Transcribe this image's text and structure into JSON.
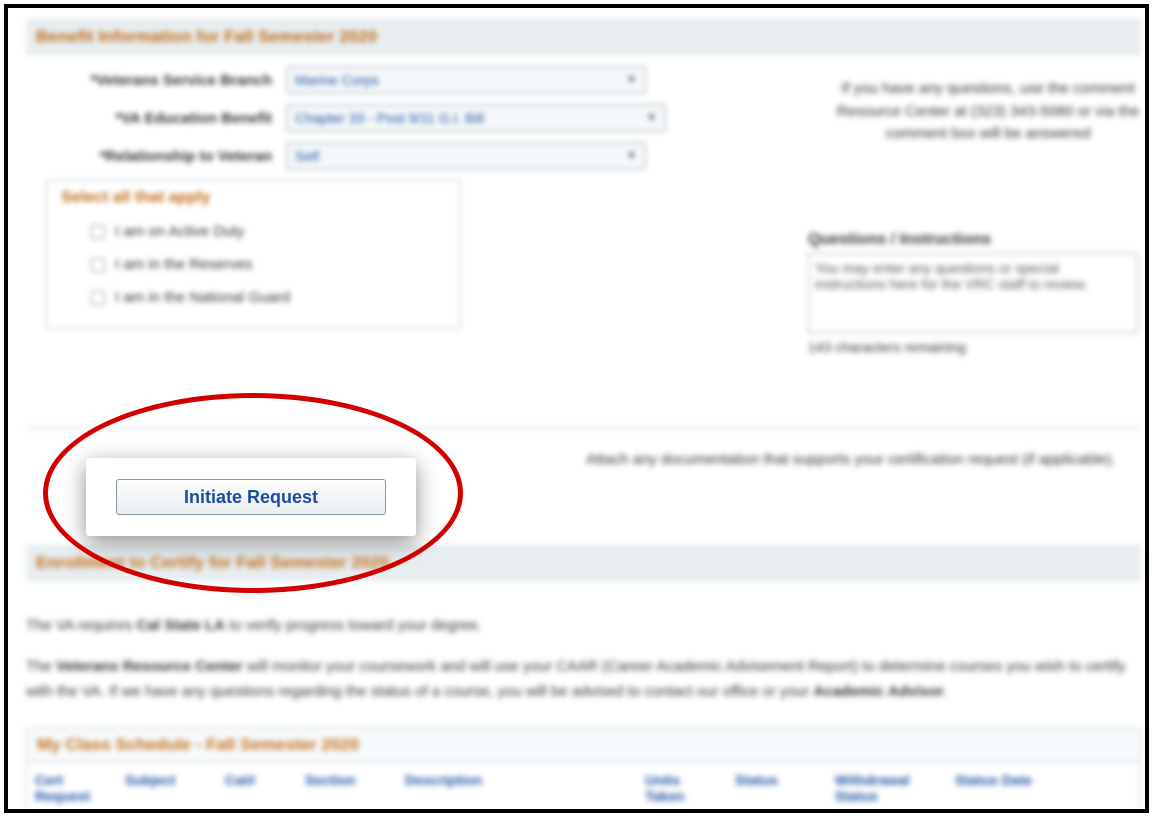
{
  "section1_title": "Benefit Information for Fall Semester 2020",
  "labels": {
    "branch": "*Veterans Service Branch",
    "benefit": "*VA Education Benefit",
    "relationship": "*Relationship to Veteran"
  },
  "dropdowns": {
    "branch": "Marine Corps",
    "benefit": "Chapter 33 - Post 9/11 G.I. Bill",
    "relationship": "Self"
  },
  "select_all": {
    "title": "Select all that apply",
    "items": [
      "I am on Active Duty",
      "I am in the Reserves",
      "I am in the National Guard"
    ]
  },
  "right": {
    "help_line1": "If you have any questions, use the comment",
    "help_line2": "Resource Center at (323) 343-5080 or via the",
    "help_line3": "comment box will be answered",
    "qi_label": "Questions / Instructions",
    "qi_placeholder": "You may enter any questions or special instructions here for the VRC staff to review.",
    "qi_remaining": "143 characters remaining"
  },
  "attach_text": "Attach any documentation that supports your certification request (if applicable).",
  "initiate_button": "Initiate Request",
  "section2_title": "Enrollment to Certify for Fall Semester 2020",
  "para1_prefix": "The VA requires ",
  "para1_bold": "Cal State LA",
  "para1_suffix": " to verify progress toward your degree.",
  "para2_prefix": "The ",
  "para2_bold": "Veterans Resource Center",
  "para2_mid": " will monitor your coursework and will use your CAAR (Career Academic Advisement Report) to determine courses you wish to certify with the VA. If we have any questions regarding the status of a course, you will be advised to contact our office or your ",
  "para2_bold2": "Academic Advisor",
  "para2_end": ".",
  "schedule_title": "My Class Schedule - Fall Semester 2020",
  "table_headers": [
    "Cert Request",
    "Subject",
    "Cat#",
    "Section",
    "Description",
    "Units Taken",
    "Status",
    "Withdrawal Status",
    "Status Date"
  ]
}
